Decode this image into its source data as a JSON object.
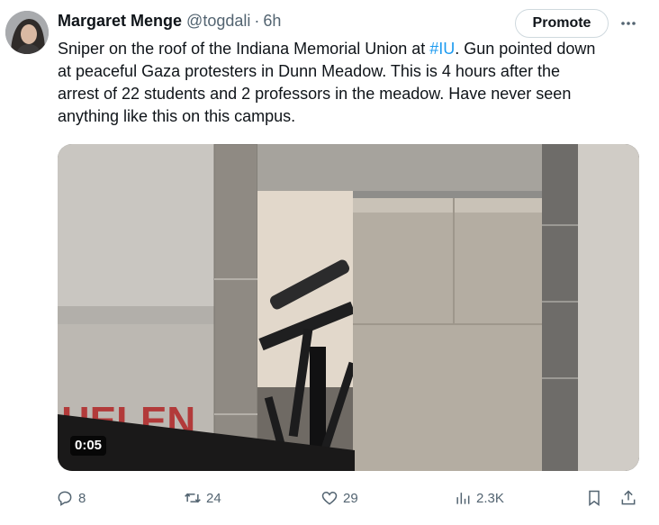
{
  "author": {
    "display_name": "Margaret Menge",
    "handle": "@togdali",
    "separator": "·",
    "time": "6h"
  },
  "header": {
    "promote_label": "Promote",
    "more_icon": "more-horizontal-icon"
  },
  "tweet": {
    "text_part1": "Sniper on the roof of the Indiana Memorial Union at ",
    "hashtag": "#IU",
    "text_part2": ". Gun pointed down\nat peaceful Gaza protesters in Dunn Meadow. This is 4 hours after the\narrest of 22 students and 2 professors in the meadow. Have never seen\nanything like this on this campus."
  },
  "media": {
    "type": "video",
    "duration": "0:05",
    "sign_text": "HELEN"
  },
  "actions": {
    "replies": {
      "icon": "reply-icon",
      "count": "8"
    },
    "reposts": {
      "icon": "repost-icon",
      "count": "24"
    },
    "likes": {
      "icon": "heart-icon",
      "count": "29"
    },
    "views": {
      "icon": "analytics-icon",
      "count": "2.3K"
    },
    "bookmark": {
      "icon": "bookmark-icon"
    },
    "share": {
      "icon": "share-icon"
    }
  },
  "colors": {
    "text": "#0f1419",
    "secondary": "#536471",
    "link": "#1d9bf0",
    "border": "#cfd9de"
  }
}
